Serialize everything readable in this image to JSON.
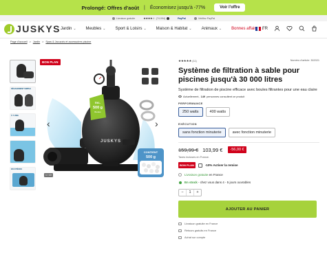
{
  "promo": {
    "title": "Prolongé: Offres d'août",
    "separator": "|",
    "text": "Économisez jusqu'à -77%",
    "button": "Voir l'offre"
  },
  "trust": {
    "item1": "Livraison gratuite",
    "stars": "★★★★☆",
    "rating": "(74.094)",
    "item3_icon": "shipping-icon",
    "paypal": "Achat en toute confiance ✓",
    "paypal_brand": "PayPal",
    "item4": "Vérifiez PayPal"
  },
  "header": {
    "logo": "JUSKYS",
    "nav": [
      "Jardin",
      "Meubles",
      "Sport & Loisirs",
      "Maison & Habitat",
      "Animaux",
      "Bonnes affaires"
    ],
    "lang": "FR",
    "colors": {
      "accent": "#a6d23c",
      "sale": "#d0021b"
    }
  },
  "breadcrumb": [
    "Page d'accueil",
    "Jardin",
    "Spas & Jacuzzis et accessoires piscine"
  ],
  "gallery": {
    "badge": "BON PLAN",
    "thumb_labels": [
      "",
      "DÉGAGEMENT SIMPLE",
      "À T VIDE",
      "",
      "EN 3 PIÈCES"
    ],
    "counter": "1 / 10",
    "product_brand": "JUSKYS",
    "tank_label": "Inc. 500 g Boules filtrantes",
    "bag_title": "CONTIENT 500 g",
    "bag_sub": "de balles filtrantes"
  },
  "product": {
    "stars": "★★★★★",
    "reviews": "(11)",
    "article": "Numéro d'article: 302021",
    "title": "Système de filtration à sable pour piscines jusqu'à 30 000 litres",
    "subtitle": "Système de filtration de piscine efficace avec boules filtrantes pour une eau claire",
    "viewers_prefix": "Actuellement,",
    "viewers_count": "149",
    "viewers_suffix": "personnes consultent ce produit",
    "performance_label": "PERFORMANCE",
    "performance_options": [
      "250 watts",
      "400 watts"
    ],
    "execution_label": "EXÉCUTION",
    "execution_options": [
      "sans fonction minuterie",
      "avec fonction minuterie"
    ],
    "old_price": "159,99 €",
    "new_price": "103,99 €",
    "discount": "-56,00 €",
    "tax": "Taxes incluses en France.",
    "bonplan_badge": "BON PLAN",
    "bonplan_text": "-10% Activer la remise",
    "shipping_free": "Livraison gratuite",
    "shipping_free_suffix": "en France",
    "stock": "En stock",
    "stock_suffix": "- chez vous dans 4 - 5 jours ouvrables",
    "qty": "1",
    "qty_minus": "−",
    "qty_plus": "+",
    "cart_button": "AJOUTER AU PANIER",
    "perks": [
      "Livraison gratuite en France",
      "Retours gratuits en France",
      "Achat sur compte"
    ]
  }
}
